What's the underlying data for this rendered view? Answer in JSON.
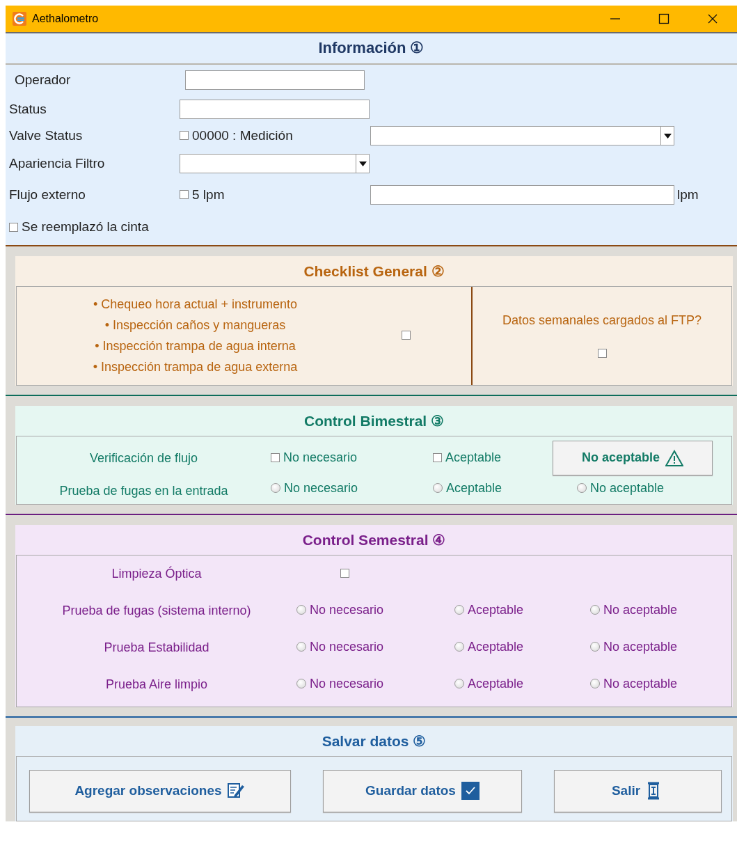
{
  "window": {
    "title": "Aethalometro"
  },
  "informacion": {
    "title": "Información ①",
    "fields": [
      {
        "kind": "text",
        "label": "Operador"
      },
      {
        "kind": "text",
        "label": "Status"
      },
      {
        "kind": "check_combo",
        "label": "Valve Status",
        "check_label": "00000 : Medición",
        "checked": false
      },
      {
        "kind": "combo",
        "label": "Apariencia Filtro"
      },
      {
        "kind": "check_text",
        "label": "Flujo externo",
        "check_label": "5 lpm",
        "checked": false,
        "unit": "lpm"
      }
    ],
    "tape_check": {
      "label": "Se reemplazó la cinta",
      "checked": false
    }
  },
  "checklist": {
    "title": "Checklist General ②",
    "items": [
      "• Chequeo hora actual + instrumento",
      "• Inspección caños y mangueras",
      "• Inspección trampa de agua interna",
      "• Inspección trampa de agua externa"
    ],
    "items_checked": false,
    "ftp": {
      "label": "Datos semanales cargados al FTP?",
      "checked": false
    }
  },
  "bimestral": {
    "title": "Control Bimestral ③",
    "rows": [
      {
        "kind": "checks",
        "label": "Verificación de flujo",
        "options": [
          {
            "label": "No necesario",
            "checked": false
          },
          {
            "label": "Aceptable",
            "checked": false
          }
        ],
        "button": "No aceptable"
      },
      {
        "kind": "radios",
        "label": "Prueba de fugas en la entrada",
        "options": [
          {
            "label": "No necesario",
            "selected": false
          },
          {
            "label": "Aceptable",
            "selected": false
          },
          {
            "label": "No aceptable",
            "selected": false
          }
        ]
      }
    ]
  },
  "semestral": {
    "title": "Control Semestral ④",
    "rows": [
      {
        "kind": "check",
        "label": "Limpieza Óptica",
        "checked": false
      },
      {
        "kind": "radios",
        "label": "Prueba de fugas (sistema interno)",
        "options": [
          {
            "label": "No necesario",
            "selected": false
          },
          {
            "label": "Aceptable",
            "selected": false
          },
          {
            "label": "No aceptable",
            "selected": false
          }
        ]
      },
      {
        "kind": "radios",
        "label": "Prueba Estabilidad",
        "options": [
          {
            "label": "No necesario",
            "selected": false
          },
          {
            "label": "Aceptable",
            "selected": false
          },
          {
            "label": "No aceptable",
            "selected": false
          }
        ]
      },
      {
        "kind": "radios",
        "label": "Prueba Aire limpio",
        "options": [
          {
            "label": "No necesario",
            "selected": false
          },
          {
            "label": "Aceptable",
            "selected": false
          },
          {
            "label": "No aceptable",
            "selected": false
          }
        ]
      }
    ]
  },
  "salvar": {
    "title": "Salvar datos ⑤",
    "buttons": [
      {
        "label": "Agregar observaciones"
      },
      {
        "label": "Guardar datos"
      },
      {
        "label": "Salir"
      }
    ]
  }
}
